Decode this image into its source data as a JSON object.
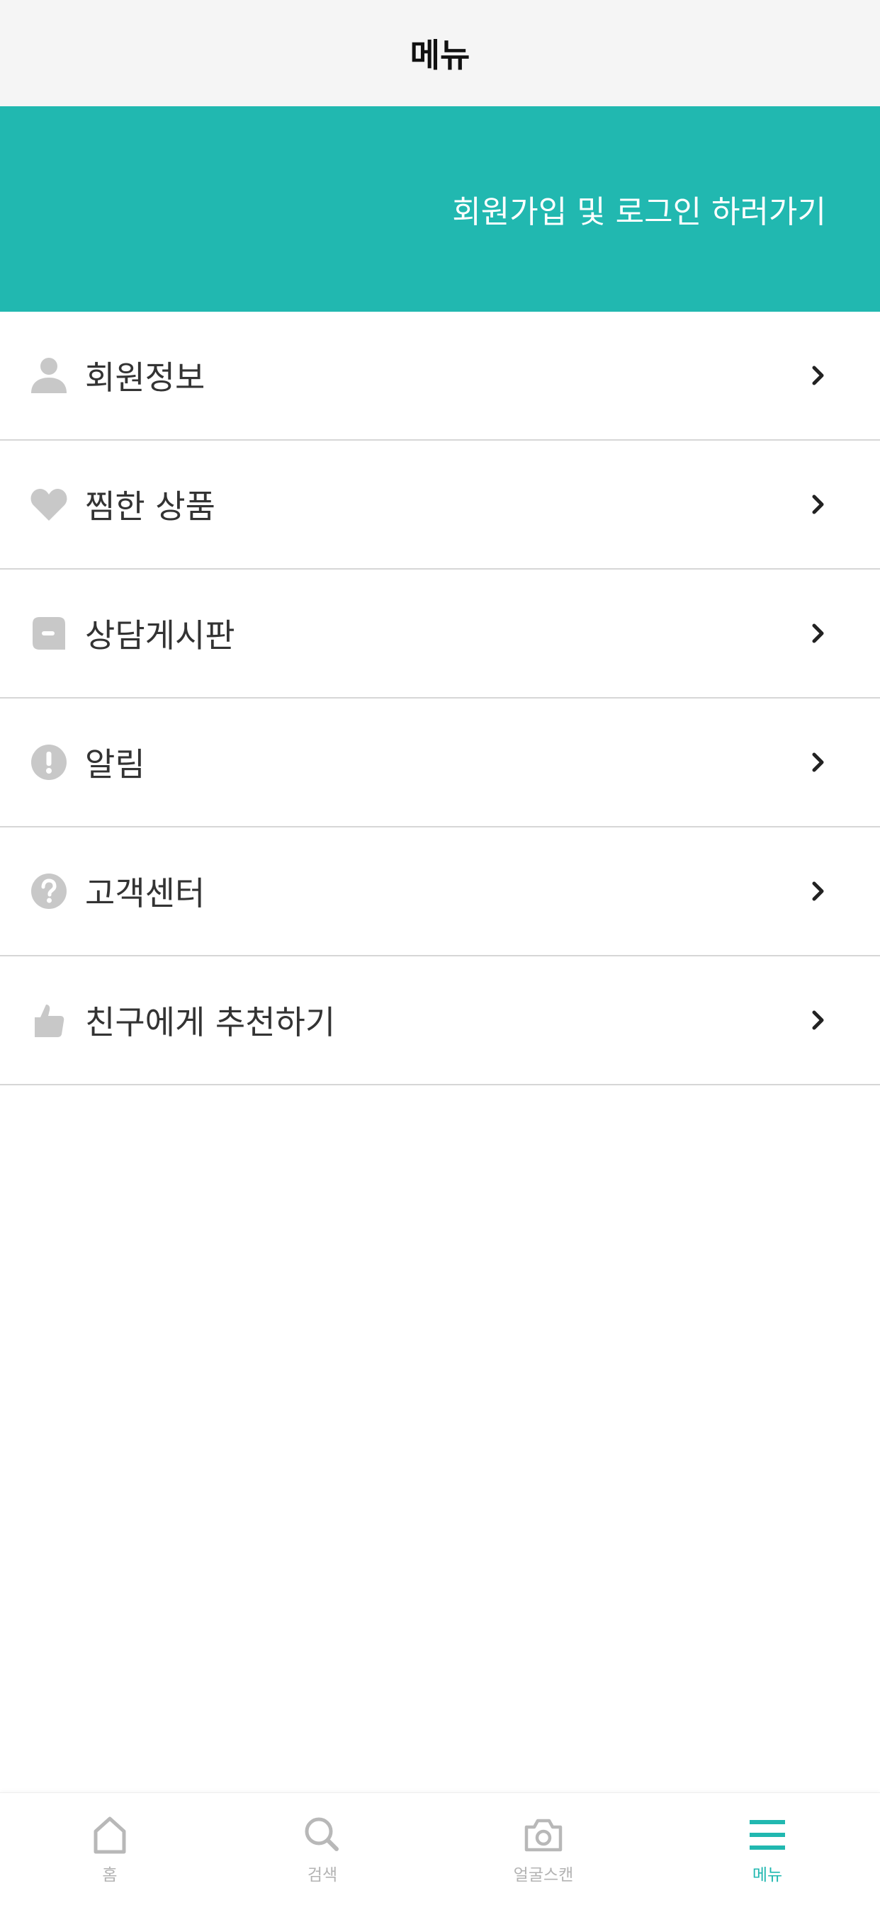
{
  "header": {
    "title": "메뉴"
  },
  "banner": {
    "link_text": "회원가입 및 로그인 하러가기",
    "background": "#21b8b0"
  },
  "menu": {
    "items": [
      {
        "label": "회원정보",
        "icon": "person-icon"
      },
      {
        "label": "찜한 상품",
        "icon": "heart-icon"
      },
      {
        "label": "상담게시판",
        "icon": "chat-bubble-icon"
      },
      {
        "label": "알림",
        "icon": "alert-icon"
      },
      {
        "label": "고객센터",
        "icon": "help-icon"
      },
      {
        "label": "친구에게 추천하기",
        "icon": "thumbs-up-icon"
      }
    ]
  },
  "tabbar": {
    "tabs": [
      {
        "label": "홈",
        "icon": "home-icon",
        "active": false
      },
      {
        "label": "검색",
        "icon": "search-icon",
        "active": false
      },
      {
        "label": "얼굴스캔",
        "icon": "camera-icon",
        "active": false
      },
      {
        "label": "메뉴",
        "icon": "menu-icon",
        "active": true
      }
    ],
    "accent": "#21b8b0",
    "inactive_color": "#b3b3b3"
  }
}
